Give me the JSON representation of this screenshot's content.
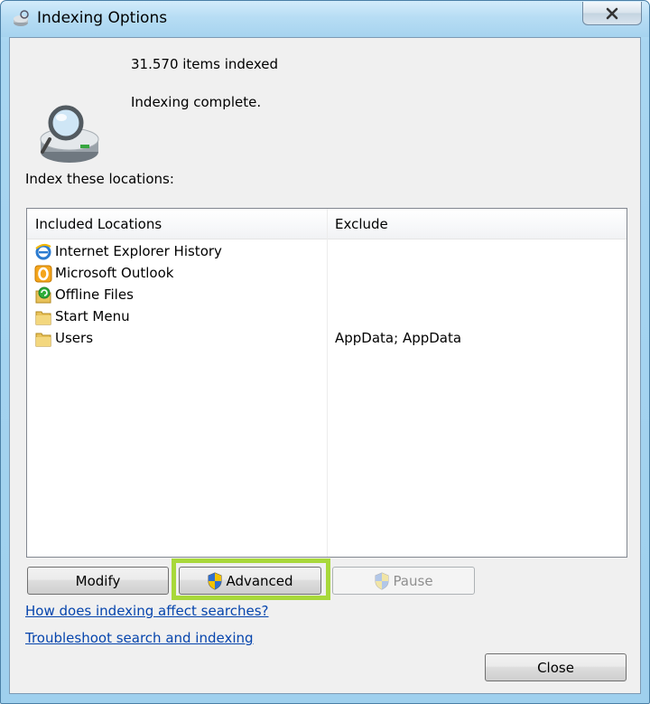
{
  "window": {
    "title": "Indexing Options",
    "close_glyph": "✕"
  },
  "summary": {
    "items_indexed": "31.570 items indexed",
    "status": "Indexing complete."
  },
  "locations": {
    "label": "Index these locations:",
    "columns": [
      "Included Locations",
      "Exclude"
    ],
    "rows": [
      {
        "name": "Internet Explorer History",
        "exclude": "",
        "icon": "ie-icon"
      },
      {
        "name": "Microsoft Outlook",
        "exclude": "",
        "icon": "outlook-icon"
      },
      {
        "name": "Offline Files",
        "exclude": "",
        "icon": "offline-files-icon"
      },
      {
        "name": "Start Menu",
        "exclude": "",
        "icon": "folder-icon"
      },
      {
        "name": "Users",
        "exclude": "AppData; AppData",
        "icon": "folder-icon"
      }
    ]
  },
  "buttons": {
    "modify": "Modify",
    "advanced": "Advanced",
    "pause": "Pause",
    "close": "Close"
  },
  "links": {
    "how_indexing": "How does indexing affect searches?",
    "troubleshoot": "Troubleshoot search and indexing"
  },
  "colors": {
    "highlight": "#a8d83a",
    "link": "#0645ad"
  }
}
